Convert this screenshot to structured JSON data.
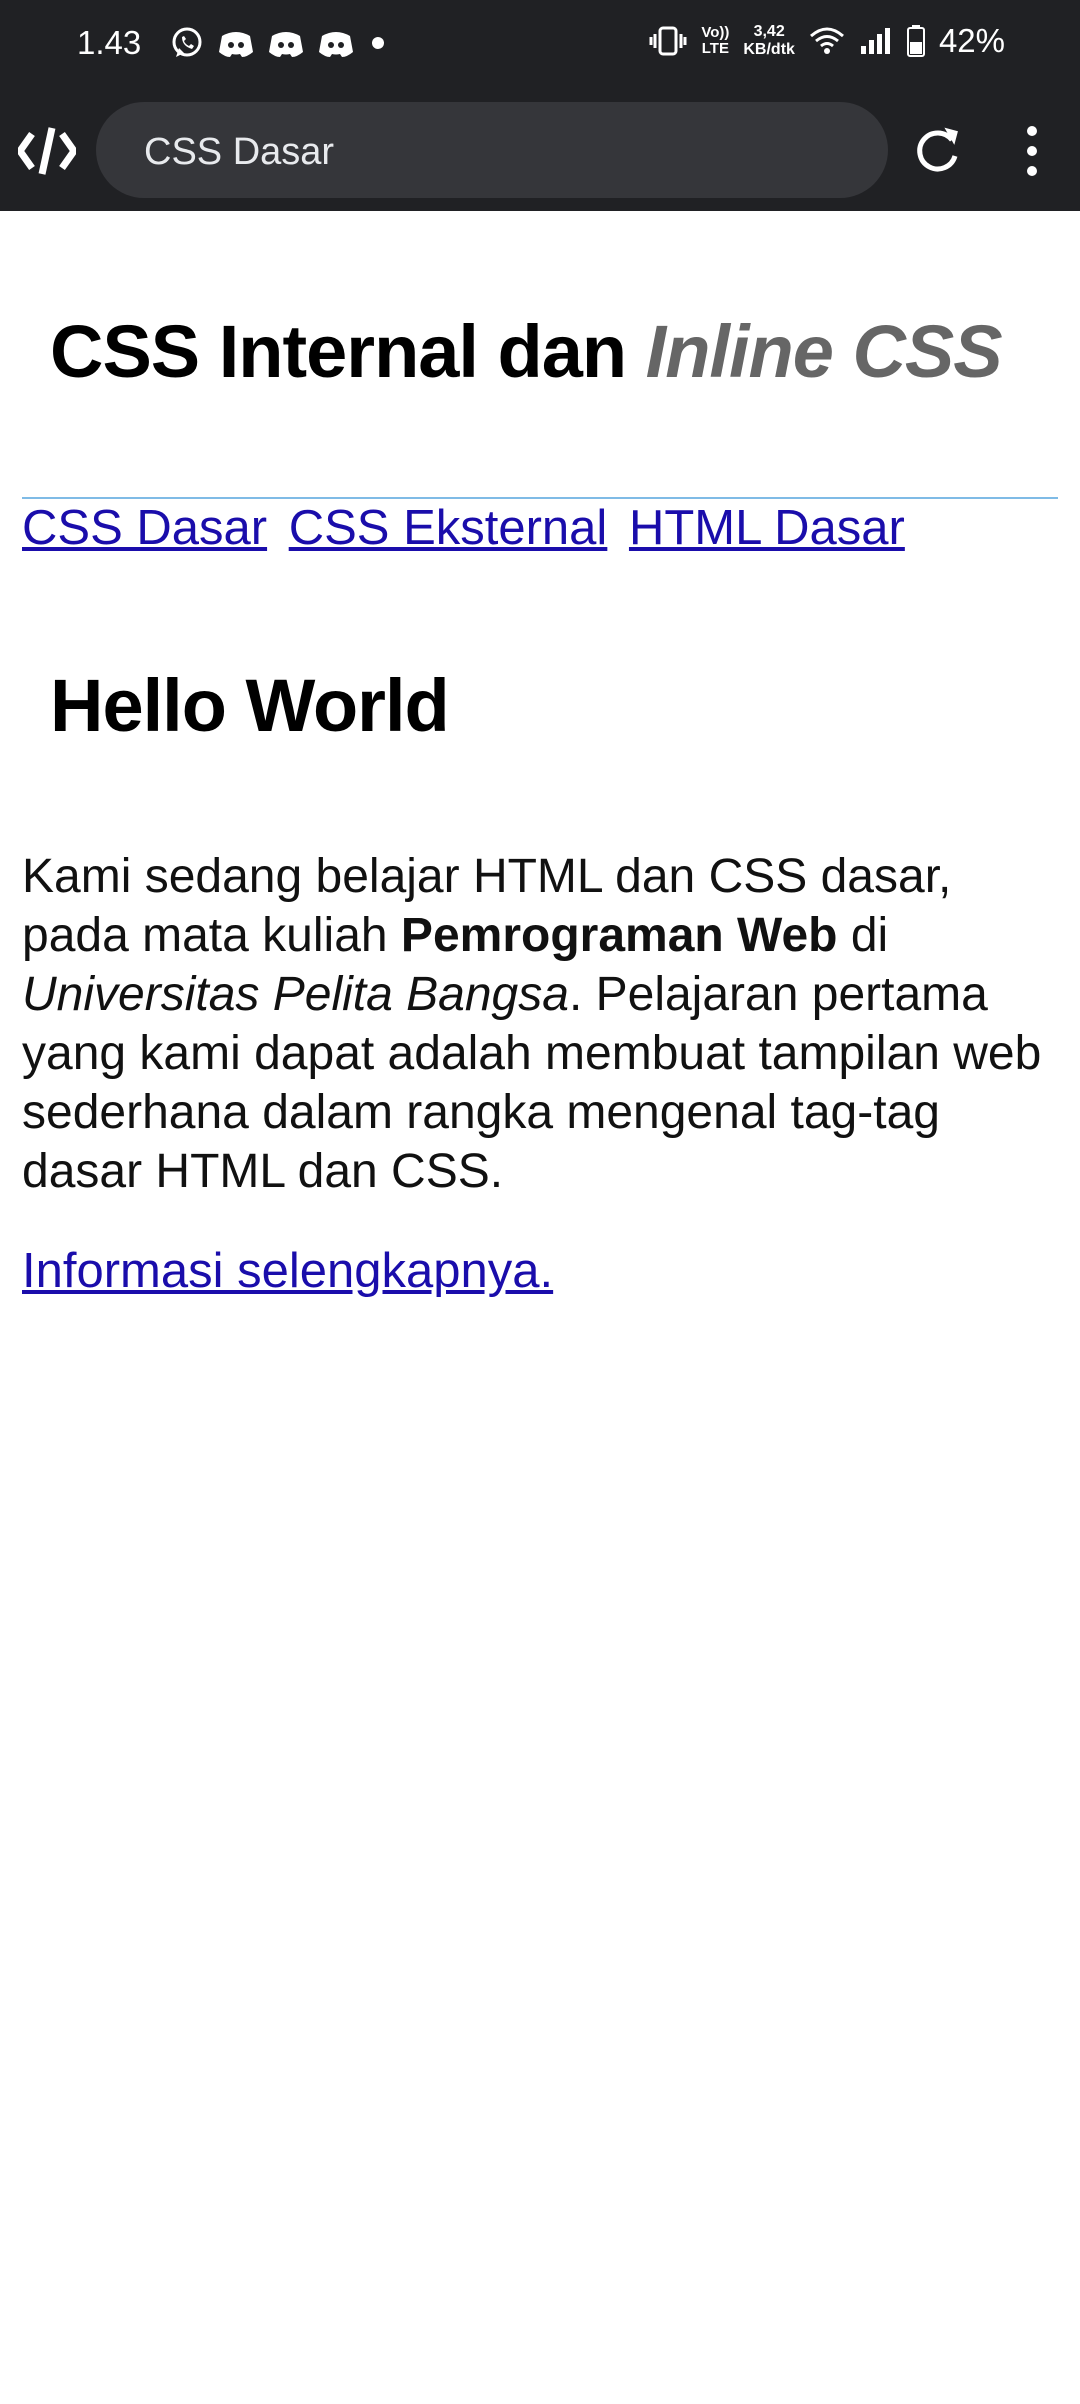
{
  "status_bar": {
    "time": "1.43",
    "speed_value": "3,42",
    "speed_unit": "KB/dtk",
    "volte_top": "Vo))",
    "volte_bottom": "LTE",
    "battery": "42%",
    "icons": [
      "whatsapp-icon",
      "discord-icon",
      "discord-icon",
      "discord-icon",
      "dot-icon",
      "vibrate-icon",
      "volte-icon",
      "wifi-icon",
      "signal-icon",
      "battery-icon"
    ]
  },
  "browser": {
    "url_text": "CSS Dasar",
    "icons": [
      "app-logo-icon",
      "reload-icon",
      "more-vert-icon"
    ]
  },
  "page": {
    "title_plain": "CSS Internal dan ",
    "title_italic": "Inline CSS",
    "nav_links": [
      "CSS Dasar",
      "CSS Eksternal",
      "HTML Dasar"
    ],
    "heading": "Hello World",
    "paragraph": {
      "part1": "Kami sedang belajar HTML dan CSS dasar, pada mata kuliah ",
      "bold": "Pemrograman Web",
      "part2": " di ",
      "italic": "Universitas Pelita Bangsa",
      "part3": ". Pelajaran pertama yang kami dapat adalah membuat tampilan web sederhana dalam rangka mengenal tag-tag dasar HTML dan CSS."
    },
    "more_link": "Informasi selengkapnya."
  },
  "colors": {
    "chrome_bg": "#202124",
    "urlbar_bg": "#35363a",
    "link": "#1a0dab",
    "title_italic": "#666666",
    "rule": "#7fbbe6"
  }
}
